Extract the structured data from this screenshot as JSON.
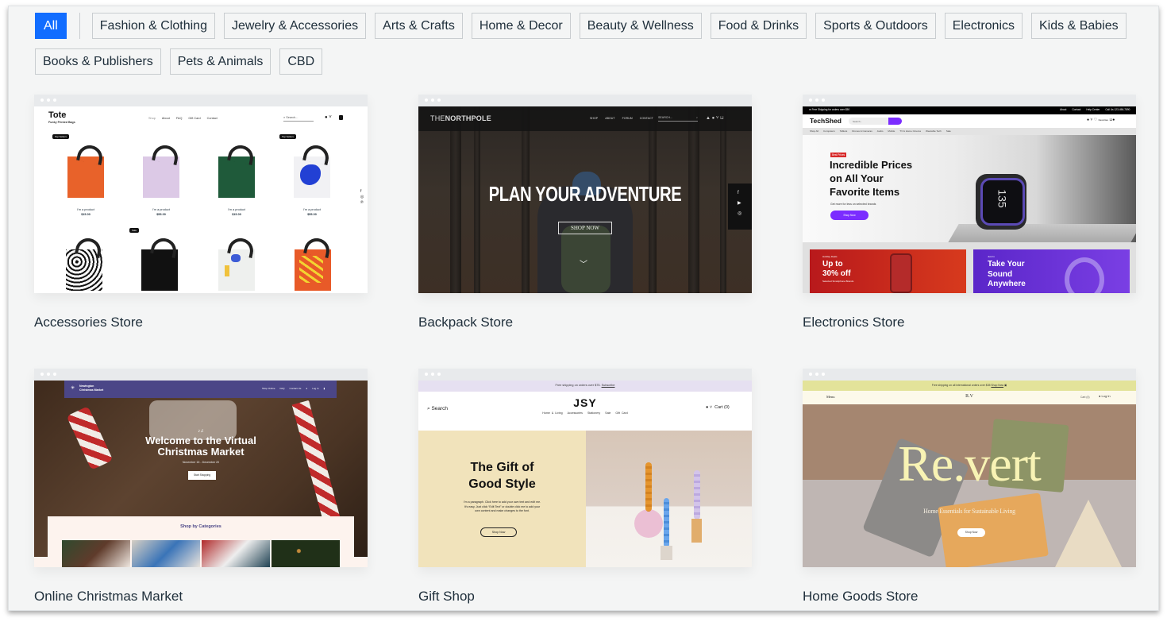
{
  "filters": {
    "row1": [
      {
        "label": "All",
        "active": true
      },
      {
        "label": "Fashion & Clothing"
      },
      {
        "label": "Jewelry & Accessories"
      },
      {
        "label": "Arts & Crafts"
      },
      {
        "label": "Home & Decor"
      },
      {
        "label": "Beauty & Wellness"
      },
      {
        "label": "Food & Drinks"
      },
      {
        "label": "Sports & Outdoors"
      },
      {
        "label": "Electronics"
      },
      {
        "label": "Kids & Babies"
      }
    ],
    "row2": [
      {
        "label": "Books & Publishers"
      },
      {
        "label": "Pets & Animals"
      },
      {
        "label": "CBD"
      }
    ]
  },
  "colors": {
    "accent": "#116dff",
    "page_bg": "#f4f5f5",
    "chip_border": "#c9cdd0",
    "text": "#20303c"
  },
  "templates": [
    {
      "title": "Accessories Store",
      "preview": {
        "brand": "Tote",
        "tagline": "Funky Printed Bags",
        "nav": [
          "Shop",
          "About",
          "FAQ",
          "Gift Card",
          "Contact"
        ],
        "search_placeholder": "Search...",
        "badges": [
          "Top Sellers",
          "Top Sellers",
          "Sale"
        ],
        "products": [
          {
            "name": "I'm a product",
            "price": "$15.00"
          },
          {
            "name": "I'm a product",
            "price": "$55.00"
          },
          {
            "name": "I'm a product",
            "price": "$15.00"
          },
          {
            "name": "I'm a product",
            "price": "$55.00"
          }
        ]
      }
    },
    {
      "title": "Backpack Store",
      "preview": {
        "brand_light": "THE",
        "brand_bold": "NORTHPOLE",
        "nav": [
          "SHOP",
          "ABOUT",
          "FORUM",
          "CONTACT"
        ],
        "search_placeholder": "SEARCH...",
        "headline": "PLAN YOUR ADVENTURE",
        "cta": "SHOP NOW"
      }
    },
    {
      "title": "Electronics Store",
      "preview": {
        "topbar_left": "Free Shipping for orders over $50",
        "topbar_right": [
          "About",
          "Contact",
          "Help Center",
          "Call Us 123-456-7890"
        ],
        "brand": "TechShed",
        "search_placeholder": "Search...",
        "wishlist": "Favorites",
        "categories": [
          "Shop All",
          "Computers",
          "Tablets",
          "Drones & Cameras",
          "Audio",
          "Mobile",
          "TV & Home Cinema",
          "Wearable Tech",
          "Sale"
        ],
        "tag": "Best Prices",
        "headline": [
          "Incredible Prices",
          "on All Your",
          "Favorite Items"
        ],
        "subline": "Get more for less on selected brands",
        "cta": "Shop Now",
        "watch_value": "135",
        "promo1": {
          "kicker": "Holiday Deals",
          "headline": [
            "Up to",
            "30% off"
          ],
          "sub": "Selected Smartphone Brands"
        },
        "promo2": {
          "kicker": "Just In",
          "headline": [
            "Take Your",
            "Sound",
            "Anywhere"
          ]
        }
      }
    },
    {
      "title": "Online Christmas Market",
      "preview": {
        "brand": [
          "Newington",
          "Christmas Market"
        ],
        "nav": [
          "Shop Online",
          "FAQ",
          "Contact Us",
          "Log In"
        ],
        "headline": [
          "Welcome to the Virtual",
          "Christmas Market"
        ],
        "dates": "November 15 - December 20",
        "cta": "Start Shopping",
        "section": "Shop by Categories"
      }
    },
    {
      "title": "Gift Shop",
      "preview": {
        "announcement": "Free shipping on orders over $75.",
        "announcement_link": "Subscribe",
        "search": "Search",
        "brand": "JSY",
        "nav": [
          "Home & Living",
          "Accessories",
          "Stationery",
          "Sale",
          "Gift Card"
        ],
        "cart": "Cart (0)",
        "headline": [
          "The Gift of",
          "Good Style"
        ],
        "paragraph": [
          "I'm a paragraph. Click here to add your own text and edit me.",
          "It's easy. Just click “Edit Text” or double click me to add your",
          "own content and make changes to the font."
        ],
        "cta": "Shop Now"
      }
    },
    {
      "title": "Home Goods Store",
      "preview": {
        "announcement": "Free shipping on all international orders over $35",
        "announcement_link": "Shop Now",
        "menu": "Menu",
        "brand": "R.V",
        "cart": "Cart (0)",
        "login": "Log In",
        "headline": "Re.vert",
        "subline": "Home Essentials for Sustainable Living",
        "cta": "Shop Now"
      }
    }
  ]
}
